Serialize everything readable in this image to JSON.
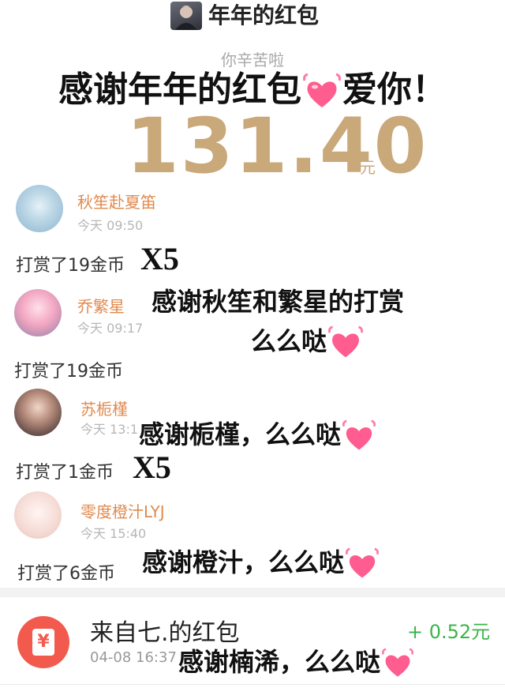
{
  "header": {
    "title": "年年的红包"
  },
  "summary": {
    "subtitle": "你辛苦啦",
    "banner": "感谢年年的红包",
    "banner_suffix": "爱你！",
    "amount": "131.40",
    "unit": "元"
  },
  "entries": [
    {
      "name": "秋笙赴夏笛",
      "time": "今天 09:50",
      "tip": "打赏了19金币",
      "mark": "X5"
    },
    {
      "name": "乔繁星",
      "time": "今天 09:17",
      "tip": "打赏了19金币"
    },
    {
      "name": "苏栀槿",
      "time": "今天 13:1",
      "tip": "打赏了1金币",
      "mark": "X5"
    },
    {
      "name": "零度橙汁LYJ",
      "time": "今天 15:40",
      "tip": "打赏了6金币"
    }
  ],
  "overlays": {
    "thanks1_line1": "感谢秋笙和繁星的打赏",
    "thanks1_line2": "么么哒",
    "thanks2": "感谢栀槿，么么哒",
    "thanks3": "感谢橙汁，么么哒",
    "thanks4": "感谢楠浠，么么哒"
  },
  "redpacket": {
    "icon": "yuan-icon",
    "icon_symbol": "¥",
    "title": "来自七.的红包",
    "amount": "+ 0.52元",
    "time": "04-08 16:37"
  },
  "colors": {
    "gold": "#c9a87a",
    "nickname": "#e08a4e",
    "heart": "#ff5d8f",
    "red": "#f25a4d",
    "green": "#3bb44a"
  }
}
